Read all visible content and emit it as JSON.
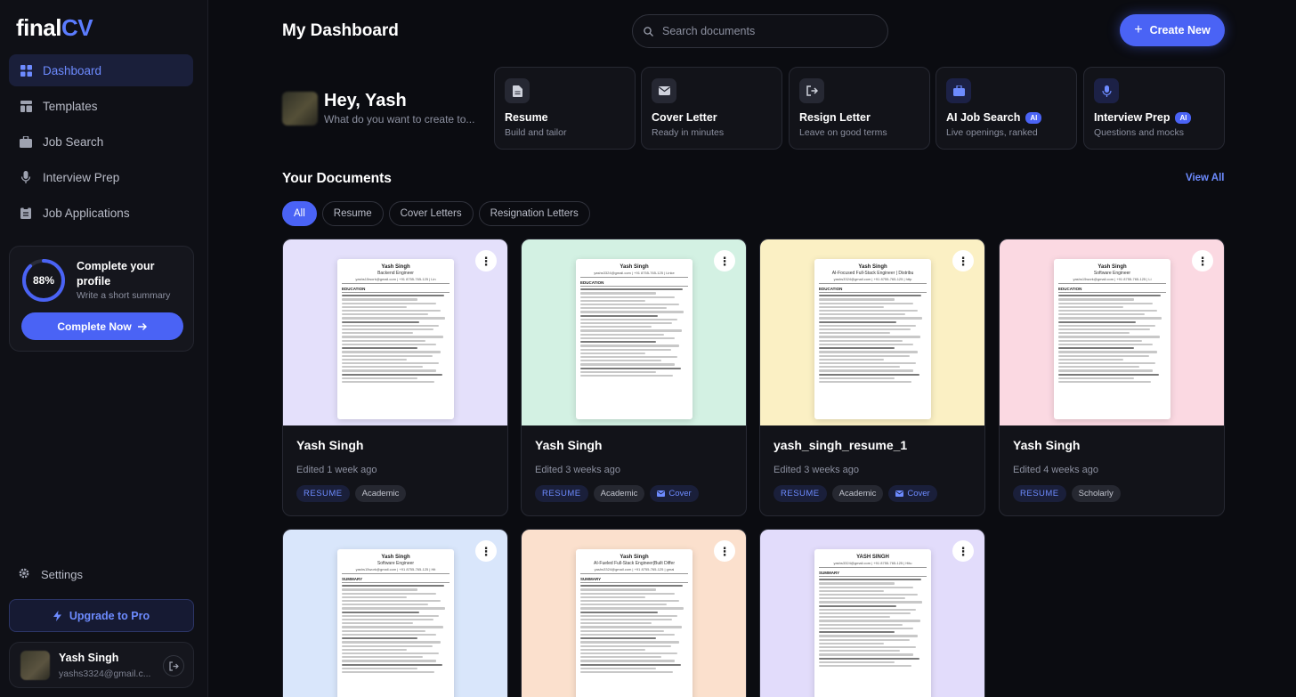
{
  "logo": {
    "part1": "final",
    "part2": "CV"
  },
  "sidebar": {
    "items": [
      {
        "label": "Dashboard",
        "icon": "grid-icon",
        "active": true
      },
      {
        "label": "Templates",
        "icon": "layout-icon"
      },
      {
        "label": "Job Search",
        "icon": "briefcase-icon"
      },
      {
        "label": "Interview Prep",
        "icon": "microphone-icon"
      },
      {
        "label": "Job Applications",
        "icon": "clipboard-icon"
      }
    ],
    "profile": {
      "percent": 88,
      "percent_label": "88%",
      "title": "Complete your profile",
      "subtitle": "Write a short summary",
      "button": "Complete Now"
    },
    "settings_label": "Settings",
    "upgrade_label": "Upgrade to Pro",
    "user": {
      "name": "Yash Singh",
      "email": "yashs3324@gmail.c..."
    }
  },
  "header": {
    "title": "My Dashboard",
    "search_placeholder": "Search documents",
    "create_label": "Create New"
  },
  "greeting": {
    "title": "Hey, Yash",
    "subtitle": "What do you want to create to..."
  },
  "quick_actions": [
    {
      "title": "Resume",
      "subtitle": "Build and tailor",
      "icon": "document-icon",
      "ai": false
    },
    {
      "title": "Cover Letter",
      "subtitle": "Ready in minutes",
      "icon": "mail-icon",
      "ai": false
    },
    {
      "title": "Resign Letter",
      "subtitle": "Leave on good terms",
      "icon": "exit-icon",
      "ai": false
    },
    {
      "title": "AI Job Search",
      "subtitle": "Live openings, ranked",
      "icon": "briefcase-icon",
      "ai": true,
      "badge": "AI"
    },
    {
      "title": "Interview Prep",
      "subtitle": "Questions and mocks",
      "icon": "microphone-icon",
      "ai": true,
      "badge": "AI"
    }
  ],
  "documents": {
    "title": "Your Documents",
    "view_all": "View All",
    "filters": [
      "All",
      "Resume",
      "Cover Letters",
      "Resignation Letters"
    ],
    "active_filter": "All",
    "items": [
      {
        "name": "Yash Singh",
        "edited": "Edited 1 week ago",
        "bg": "#e4e0fb",
        "resume_name": "Yash Singh",
        "role": "Backend Engineer",
        "contact": "yashs15work@gmail.com | +91 8755-765-125 | Lin",
        "first_section": "EDUCATION",
        "tags": [
          {
            "type": "resume",
            "label": "RESUME"
          },
          {
            "type": "gray",
            "label": "Academic"
          }
        ]
      },
      {
        "name": "Yash Singh",
        "edited": "Edited 3 weeks ago",
        "bg": "#d3f1e3",
        "resume_name": "Yash Singh",
        "role": "",
        "contact": "yashs3324@gmail.com | +91 8755-765-125 | Linke",
        "first_section": "EDUCATION",
        "tags": [
          {
            "type": "resume",
            "label": "RESUME"
          },
          {
            "type": "gray",
            "label": "Academic"
          },
          {
            "type": "cover",
            "label": "Cover"
          }
        ]
      },
      {
        "name": "yash_singh_resume_1",
        "edited": "Edited 3 weeks ago",
        "bg": "#fbf0c4",
        "resume_name": "Yash Singh",
        "role": "AI-Focused Full-Stack Engineer | Distribu",
        "contact": "yashs3324@gmail.com | +91 8755-765-125 | http",
        "first_section": "EDUCATION",
        "tags": [
          {
            "type": "resume",
            "label": "RESUME"
          },
          {
            "type": "gray",
            "label": "Academic"
          },
          {
            "type": "cover",
            "label": "Cover"
          }
        ]
      },
      {
        "name": "Yash Singh",
        "edited": "Edited 4 weeks ago",
        "bg": "#fbd9e2",
        "resume_name": "Yash Singh",
        "role": "Software Engineer",
        "contact": "yashs15work@gmail.com | +91 8755-765-125 | Li",
        "first_section": "EDUCATION",
        "tags": [
          {
            "type": "resume",
            "label": "RESUME"
          },
          {
            "type": "gray",
            "label": "Scholarly"
          }
        ]
      },
      {
        "name": "",
        "edited": "",
        "bg": "#d9e6fb",
        "resume_name": "Yash Singh",
        "role": "Software Engineer",
        "contact": "yashs15work@gmail.com | +91 8755-765-125 | Hit",
        "first_section": "SUMMARY",
        "tags": []
      },
      {
        "name": "",
        "edited": "",
        "bg": "#fbe0cd",
        "resume_name": "Yash Singh",
        "role": "AI-Fueled Full-Stack Engineer|Built Differ",
        "contact": "yashs3324@gmail.com | +91 8755-765-125 | gmai",
        "first_section": "SUMMARY",
        "tags": []
      },
      {
        "name": "",
        "edited": "",
        "bg": "#e2dcfb",
        "resume_name": "YASH SINGH",
        "role": "",
        "contact": "yashs3324@gmail.com | +91 8755-765-125 | Hitu",
        "first_section": "SUMMARY",
        "tags": []
      }
    ]
  },
  "colors": {
    "accent": "#4a63f5",
    "accent_text": "#6d8bff",
    "background": "#0b0c11",
    "sidebar": "#0f1016"
  }
}
